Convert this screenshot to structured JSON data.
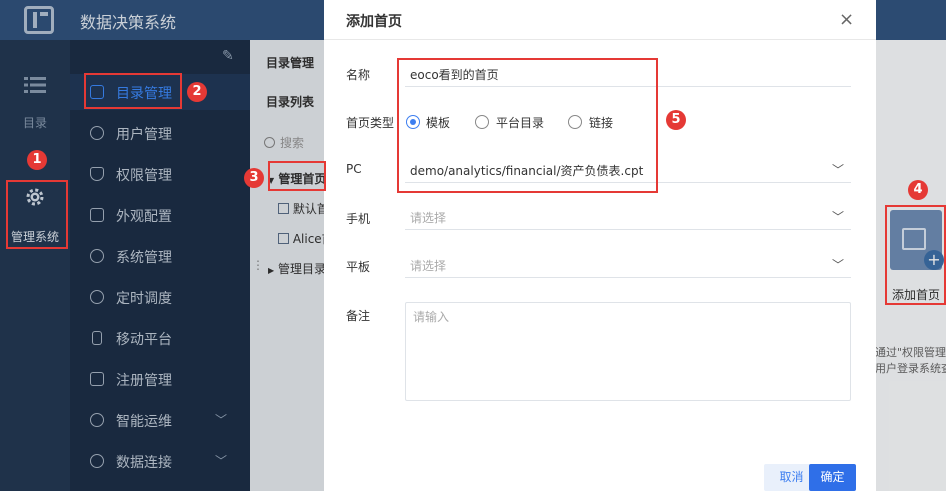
{
  "app": {
    "title": "数据决策系统"
  },
  "rail": {
    "items": [
      {
        "label": "目录",
        "icon": "list-icon"
      },
      {
        "label": "管理系统",
        "icon": "gear-icon"
      }
    ]
  },
  "sidebar": {
    "items": [
      {
        "label": "目录管理",
        "icon": "catalog-icon",
        "active": true
      },
      {
        "label": "用户管理",
        "icon": "user-icon"
      },
      {
        "label": "权限管理",
        "icon": "shield-icon"
      },
      {
        "label": "外观配置",
        "icon": "paint-roller-icon"
      },
      {
        "label": "系统管理",
        "icon": "settings-icon"
      },
      {
        "label": "定时调度",
        "icon": "timer-icon"
      },
      {
        "label": "移动平台",
        "icon": "mobile-icon"
      },
      {
        "label": "注册管理",
        "icon": "register-icon"
      },
      {
        "label": "智能运维",
        "icon": "ops-icon",
        "expandable": true
      },
      {
        "label": "数据连接",
        "icon": "link-icon",
        "expandable": true
      }
    ]
  },
  "directory": {
    "header": "目录管理",
    "list_title": "目录列表",
    "search_placeholder": "搜索",
    "tree": [
      "管理首页",
      "默认首页",
      "Alice首页",
      "管理目录"
    ]
  },
  "right_panel": {
    "add_home_label": "添加首页",
    "note_line1": "通过\"权限管理",
    "note_line2": "用户登录系统查"
  },
  "dialog": {
    "title": "添加首页",
    "name_label": "名称",
    "name_value": "eoco看到的首页",
    "type_label": "首页类型",
    "type_options": [
      "模板",
      "平台目录",
      "链接"
    ],
    "type_selected": "模板",
    "pc_label": "PC",
    "pc_value": "demo/analytics/financial/资产负债表.cpt",
    "phone_label": "手机",
    "phone_placeholder": "请选择",
    "tablet_label": "平板",
    "tablet_placeholder": "请选择",
    "remark_label": "备注",
    "remark_placeholder": "请输入",
    "cancel_label": "取消",
    "confirm_label": "确定"
  },
  "callouts": [
    "1",
    "2",
    "3",
    "4",
    "5"
  ],
  "colors": {
    "primary": "#2f6fe8",
    "callout": "#e53935",
    "topbar": "#32547f",
    "sidebar": "#1d2f48"
  }
}
